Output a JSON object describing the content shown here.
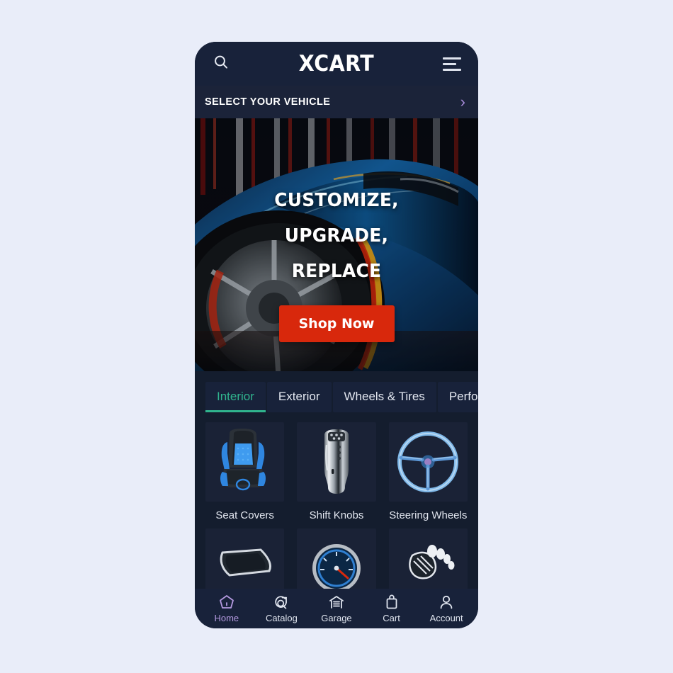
{
  "app": {
    "brand": "XCART",
    "theme": {
      "page_bg": "#e9edf9",
      "app_bg": "#141d2e",
      "bar_bg": "#18223a",
      "accent_teal": "#30b48e",
      "accent_purple": "#b49ae0",
      "cta_red": "#d8280c"
    }
  },
  "appbar": {
    "search_icon": "search-icon",
    "menu_icon": "hamburger-menu-icon",
    "title": "XCART"
  },
  "vehicle_selector": {
    "label": "SELECT YOUR VEHICLE",
    "chevron": "›",
    "chevron_icon": "chevron-right-icon"
  },
  "hero": {
    "headline_line1": "CUSTOMIZE, UPGRADE,",
    "headline_line2": "REPLACE",
    "cta_label": "Shop Now",
    "image_alt": "blue-sports-car-wheel"
  },
  "tabs": [
    {
      "label": "Interior",
      "active": true
    },
    {
      "label": "Exterior",
      "active": false
    },
    {
      "label": "Wheels & Tires",
      "active": false
    },
    {
      "label": "Performance",
      "active": false
    }
  ],
  "categories": [
    {
      "name": "Seat Covers",
      "icon": "car-seat-icon"
    },
    {
      "name": "Shift Knobs",
      "icon": "shift-knob-icon"
    },
    {
      "name": "Steering Wheels",
      "icon": "steering-wheel-icon"
    },
    {
      "name": "",
      "icon": "floor-mat-icon"
    },
    {
      "name": "",
      "icon": "gauge-icon"
    },
    {
      "name": "",
      "icon": "pedal-covers-icon"
    }
  ],
  "bottom_nav": [
    {
      "label": "Home",
      "icon": "home-icon",
      "active": true
    },
    {
      "label": "Catalog",
      "icon": "catalog-search-icon",
      "active": false
    },
    {
      "label": "Garage",
      "icon": "garage-icon",
      "active": false
    },
    {
      "label": "Cart",
      "icon": "cart-bag-icon",
      "active": false
    },
    {
      "label": "Account",
      "icon": "account-person-icon",
      "active": false
    }
  ]
}
